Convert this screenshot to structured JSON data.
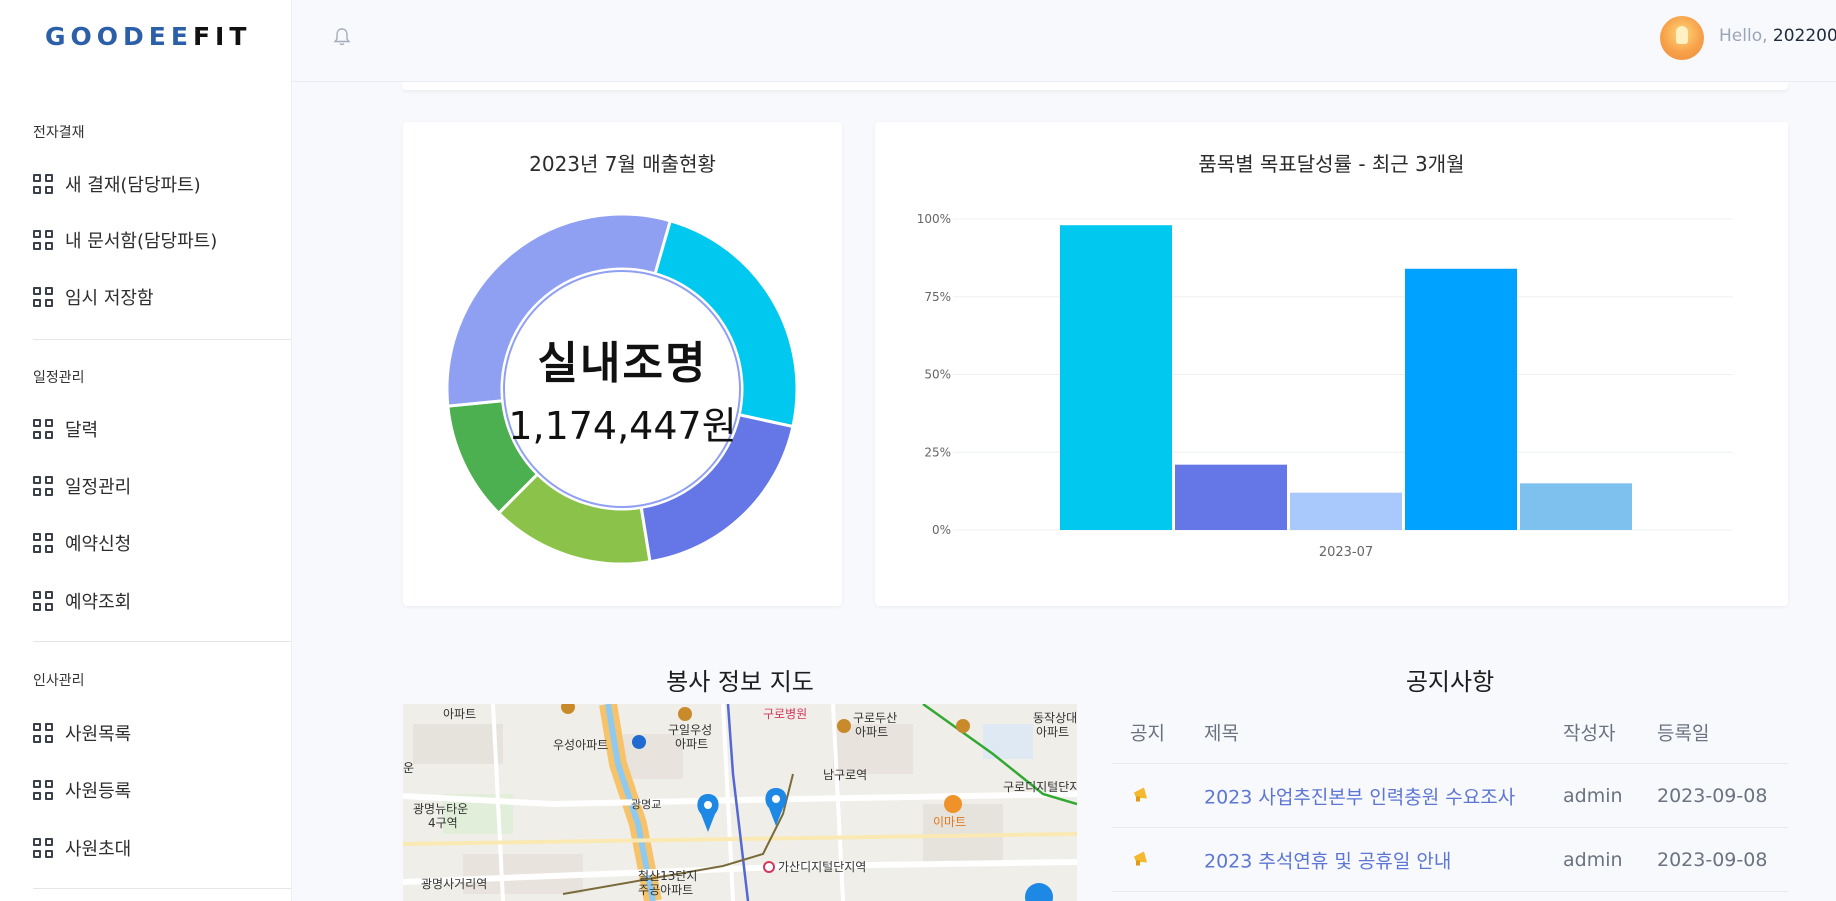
{
  "logo": {
    "part1": "GOODEE",
    "part2": "FIT"
  },
  "sidebar": {
    "sections": [
      {
        "title": "전자결재",
        "items": [
          "새 결재(담당파트)",
          "내 문서함(담당파트)",
          "임시 저장함"
        ]
      },
      {
        "title": "일정관리",
        "items": [
          "달력",
          "일정관리",
          "예약신청",
          "예약조회"
        ]
      },
      {
        "title": "인사관리",
        "items": [
          "사원목록",
          "사원등록",
          "사원초대"
        ]
      }
    ]
  },
  "header": {
    "greeting": "Hello,",
    "user": "202200"
  },
  "sales_card": {
    "title": "2023년 7월 매출현황",
    "center_name": "실내조명",
    "center_value": "1,174,447원"
  },
  "colors": {
    "accent": "#5d76d6",
    "cyan": "#00c8ee",
    "indigo": "#6576e6",
    "lightblue": "#a9c8fb",
    "blue": "#00a2ff",
    "skyblue": "#7fc1ee",
    "periwinkle": "#8f9ff2",
    "lime": "#8bc34a",
    "green": "#4caf50"
  },
  "chart_data": [
    {
      "type": "pie",
      "title": "2023년 7월 매출현황",
      "style": "donut",
      "values": [
        24,
        19,
        15,
        11,
        31
      ],
      "colors": [
        "#00c8ee",
        "#6576e6",
        "#8bc34a",
        "#4caf50",
        "#8f9ff2"
      ]
    },
    {
      "type": "bar",
      "title": "품목별 목표달성률 - 최근 3개월",
      "categories": [
        "2023-07"
      ],
      "series": [
        {
          "values": [
            98
          ],
          "color": "#00c8ee"
        },
        {
          "values": [
            21
          ],
          "color": "#6576e6"
        },
        {
          "values": [
            12
          ],
          "color": "#a9c8fb"
        },
        {
          "values": [
            84
          ],
          "color": "#00a2ff"
        },
        {
          "values": [
            15
          ],
          "color": "#7fc1ee"
        }
      ],
      "yticks": [
        "100%",
        "75%",
        "50%",
        "25%",
        "0%"
      ],
      "ylim": [
        0,
        100
      ],
      "grid": true
    }
  ],
  "map": {
    "title": "봉사 정보 지도",
    "labels": [
      "아파트",
      "우성아파트",
      "구일우성",
      "아파트",
      "구로병원",
      "구로두산",
      "아파트",
      "동작상대",
      "아파트",
      "광명교",
      "남구로역",
      "구로디지털단지",
      "이마트",
      "광명뉴타운",
      "4구역",
      "철산13단지",
      "주공아파트",
      "가산디지털단지역",
      "광명사거리역",
      "운"
    ]
  },
  "notice": {
    "title": "공지사항",
    "headers": [
      "공지",
      "제목",
      "작성자",
      "등록일"
    ],
    "rows": [
      {
        "title": "2023 사업추진본부 인력충원 수요조사",
        "author": "admin",
        "date": "2023-09-08"
      },
      {
        "title": "2023 추석연휴 및 공휴일 안내",
        "author": "admin",
        "date": "2023-09-08"
      }
    ]
  }
}
